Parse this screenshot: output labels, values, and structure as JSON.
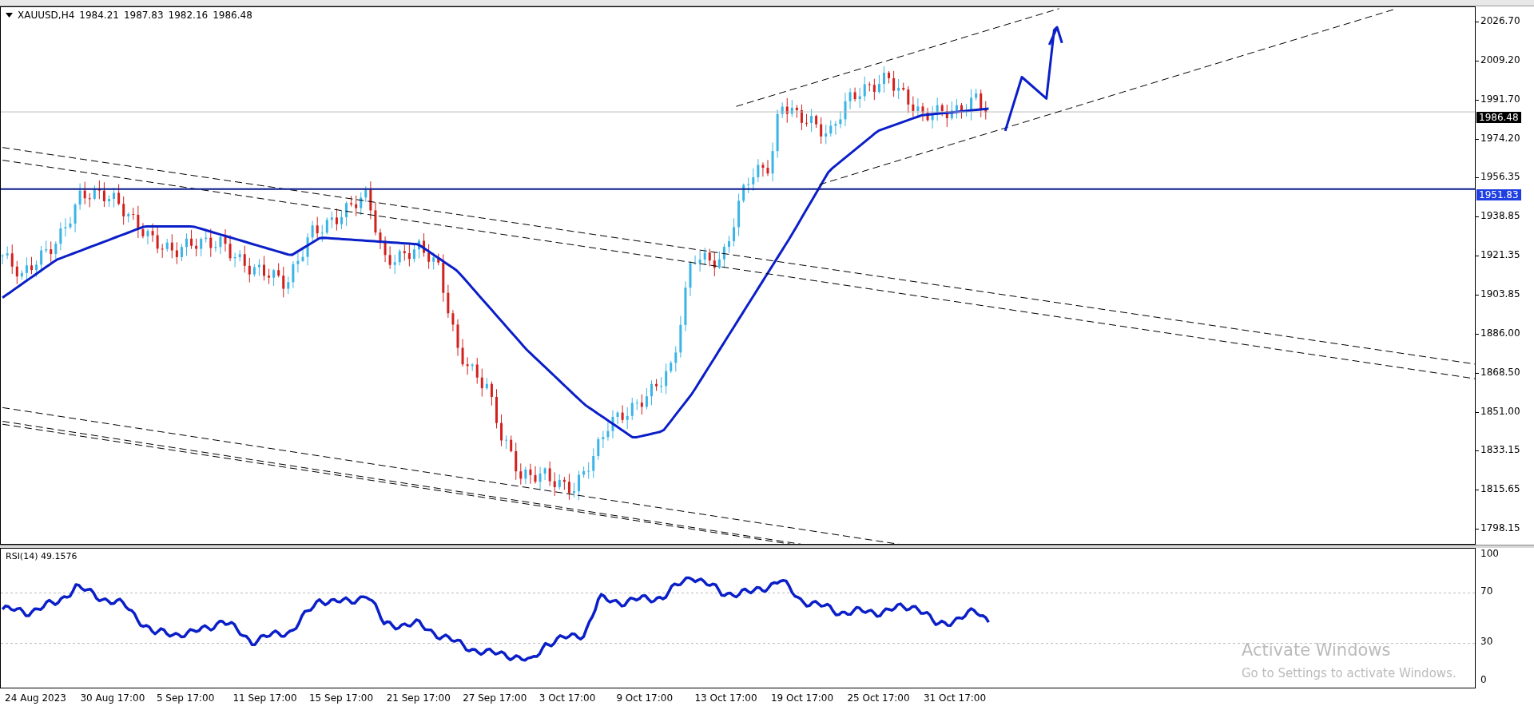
{
  "chart_header": {
    "symbol": "XAUUSD,H4",
    "ohlc": [
      "1984.21",
      "1987.83",
      "1982.16",
      "1986.48"
    ]
  },
  "price_axis": [
    "2026.70",
    "2009.20",
    "1991.70",
    "1974.20",
    "1956.35",
    "1938.85",
    "1921.35",
    "1903.85",
    "1886.00",
    "1868.50",
    "1851.00",
    "1833.15",
    "1815.65",
    "1798.15"
  ],
  "price_tags": [
    {
      "kind": "bid",
      "text": "1986.48"
    },
    {
      "kind": "hline",
      "text": "1951.83"
    }
  ],
  "rsi": {
    "label": "RSI(14) 49.1576",
    "axis": [
      "100",
      "70",
      "30",
      "0"
    ]
  },
  "time_axis": [
    "24 Aug 2023",
    "30 Aug 17:00",
    "5 Sep 17:00",
    "11 Sep 17:00",
    "15 Sep 17:00",
    "21 Sep 17:00",
    "27 Sep 17:00",
    "3 Oct 17:00",
    "9 Oct 17:00",
    "13 Oct 17:00",
    "19 Oct 17:00",
    "25 Oct 17:00",
    "31 Oct 17:00"
  ],
  "activation_notice": {
    "title": "Activate Windows",
    "subtitle": "Go to Settings to activate Windows."
  }
}
